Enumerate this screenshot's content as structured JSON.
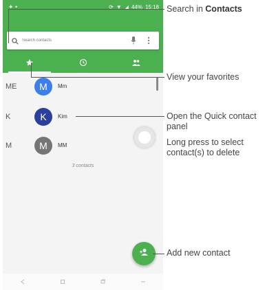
{
  "status_bar": {
    "time": "15:18",
    "battery": "44%"
  },
  "search": {
    "placeholder": "Search contacts"
  },
  "tabs": [
    {
      "icon": "star-icon",
      "active": true
    },
    {
      "icon": "clock-icon",
      "active": false
    },
    {
      "icon": "group-icon",
      "active": false
    }
  ],
  "contacts": [
    {
      "section": "ME",
      "initial": "M",
      "name": "Mm",
      "color": "#3d7fea"
    },
    {
      "section": "K",
      "initial": "K",
      "name": "Kim",
      "color": "#2a3f9e"
    },
    {
      "section": "M",
      "initial": "M",
      "name": "MM",
      "color": "#757575"
    }
  ],
  "contacts_count": "3 contacts",
  "colors": {
    "accent": "#4caf50"
  },
  "callouts": {
    "search_prefix": "Search in ",
    "search_bold": "Contacts",
    "favorites": "View your favorites",
    "quick_contact_1": "Open the Quick contact",
    "quick_contact_2": "panel",
    "long_press_1": "Long press to select",
    "long_press_2": "contact(s) to delete",
    "add_contact": "Add new contact"
  }
}
